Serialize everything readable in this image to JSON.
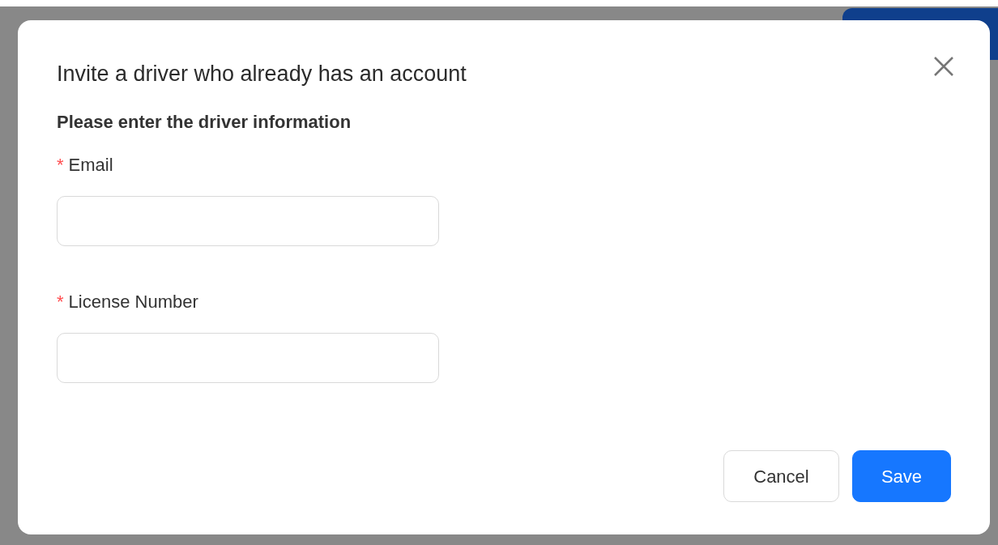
{
  "dialog": {
    "title": "Invite a driver who already has an account",
    "subtitle": "Please enter the driver information",
    "fields": [
      {
        "label": "Email",
        "required_mark": "*"
      },
      {
        "label": "License Number",
        "required_mark": "*"
      }
    ],
    "buttons": [
      {
        "label": "Cancel",
        "kind": "secondary"
      },
      {
        "label": "Save",
        "kind": "primary"
      }
    ]
  }
}
